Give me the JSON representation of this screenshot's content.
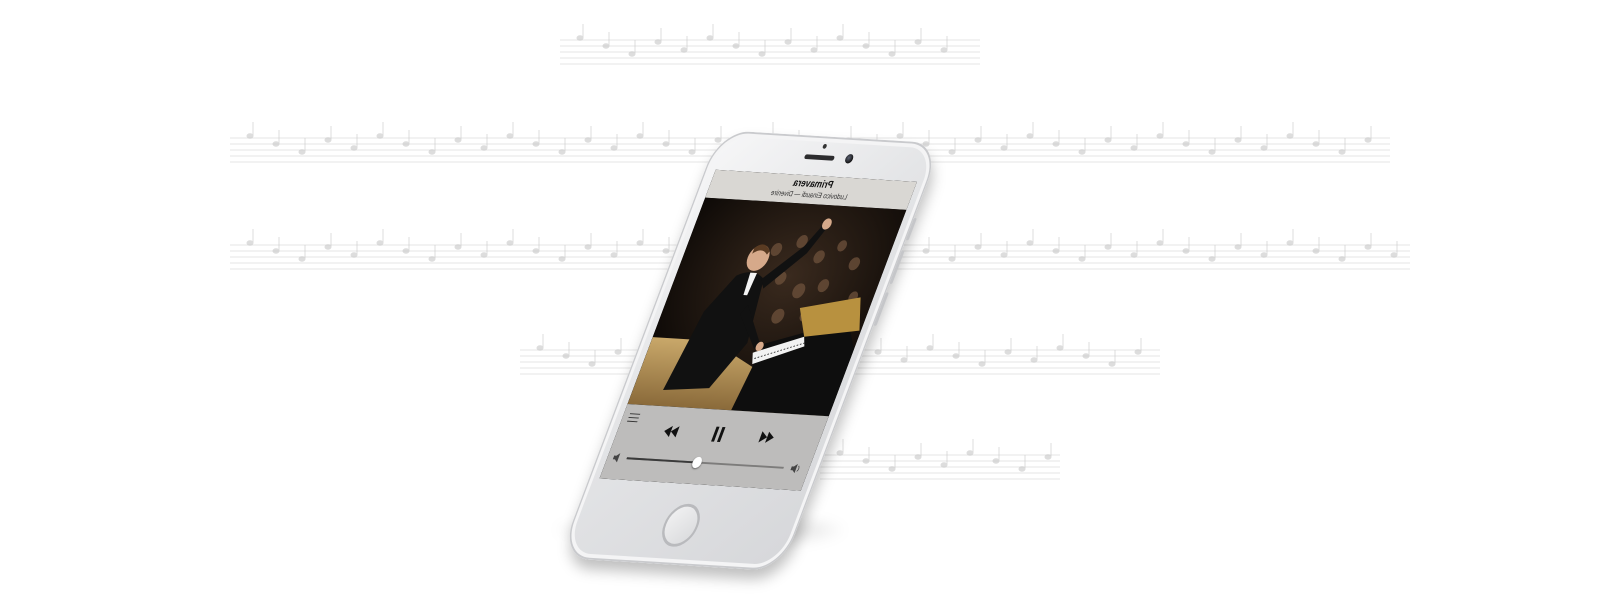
{
  "player": {
    "track_title": "Primavera",
    "track_subtitle": "Ludovico Einaudi — Divenire",
    "volume_level": 0.45
  },
  "icons": [
    "list-icon",
    "rewind-icon",
    "pause-icon",
    "fast-forward-icon",
    "volume-low-icon",
    "volume-high-icon"
  ]
}
